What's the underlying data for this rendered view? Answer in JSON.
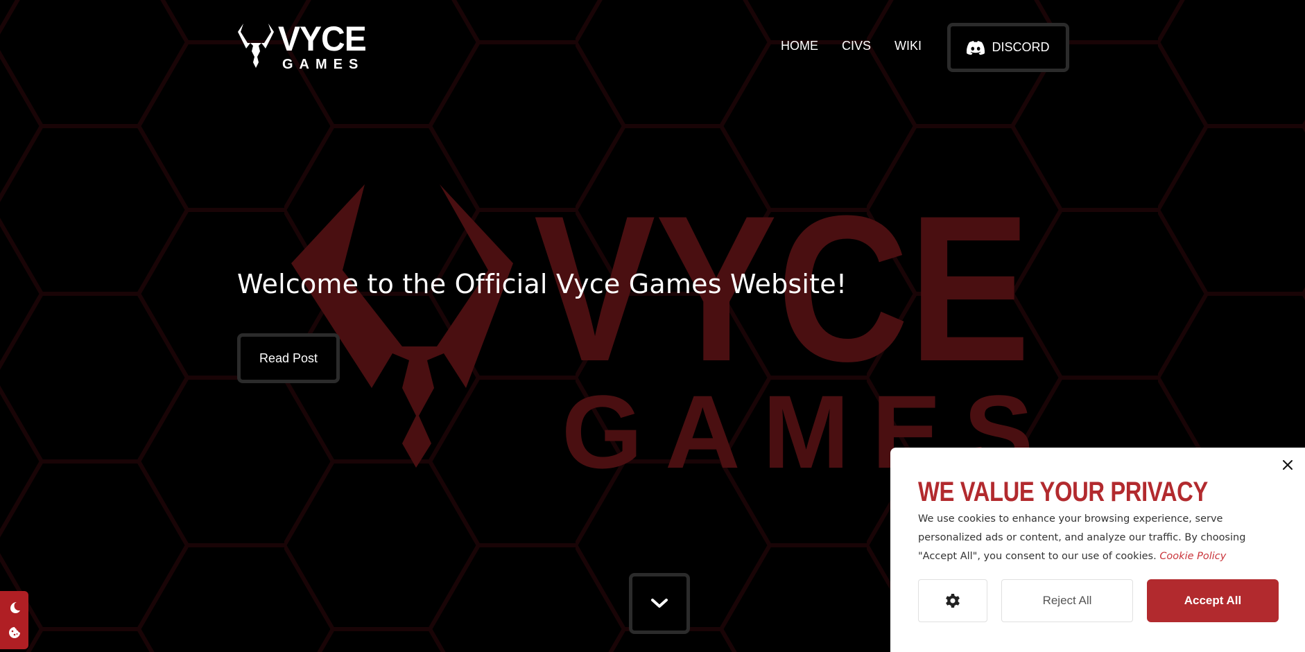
{
  "nav": {
    "logo_main": "VYCE",
    "logo_sub": "GAMES",
    "links": [
      {
        "label": "HOME"
      },
      {
        "label": "CIVS"
      },
      {
        "label": "WIKI"
      }
    ],
    "discord_label": "DISCORD"
  },
  "hero": {
    "bg_logo_main": "VYCE",
    "bg_logo_sub": "GAMES",
    "title": "Welcome to the Official Vyce Games Website!",
    "read_post_label": "Read Post",
    "scroll_icon": "chevron-down-icon"
  },
  "side_widget": {
    "icons": [
      "moon-icon",
      "cookie-icon"
    ]
  },
  "cookie_banner": {
    "title": "WE VALUE YOUR PRIVACY",
    "text": "We use cookies to enhance your browsing experience, serve personalized ads or content, and analyze our traffic. By choosing \"Accept All\", you consent to our use of cookies.",
    "policy_link": "Cookie Policy",
    "reject_label": "Reject All",
    "accept_label": "Accept All"
  },
  "colors": {
    "background": "#000000",
    "accent_red": "#b22a2e",
    "bg_logo_red": "#4a0f11",
    "hex_lines": "#1c0507",
    "button_border": "#2b2b2b"
  }
}
